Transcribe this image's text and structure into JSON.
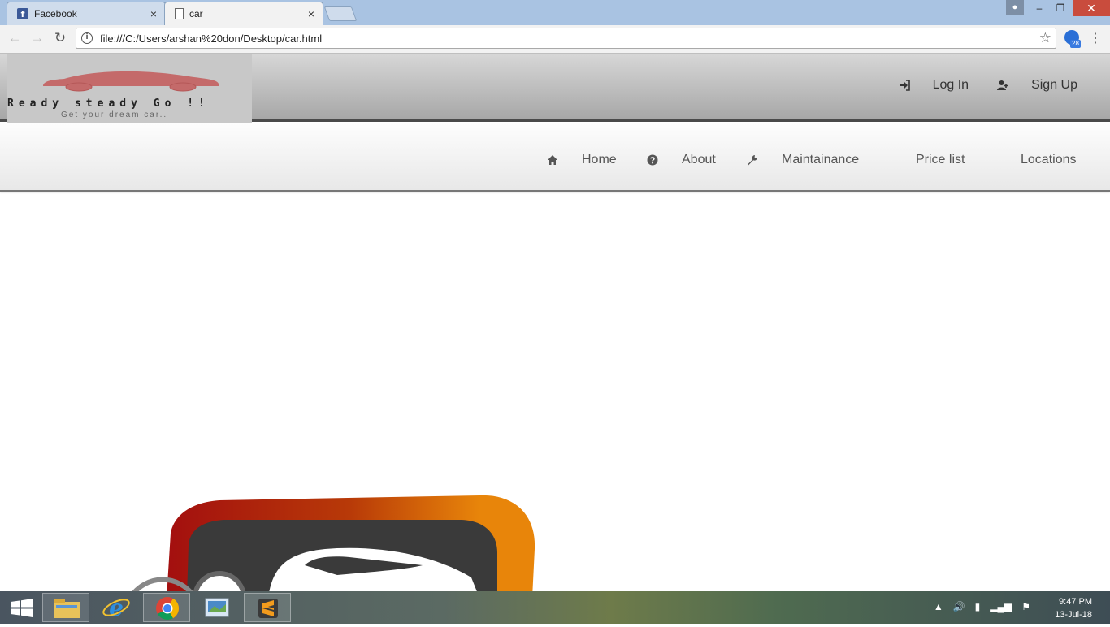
{
  "browser": {
    "tabs": [
      {
        "title": "Facebook",
        "favicon": "facebook-icon",
        "active": false
      },
      {
        "title": "car",
        "favicon": "document-icon",
        "active": true
      }
    ],
    "close_glyph": "×",
    "url": "file:///C:/Users/arshan%20don/Desktop/car.html",
    "extension_badge": "28"
  },
  "site": {
    "tagline": "Ready steady Go !!",
    "subtagline": "Get your dream car..",
    "auth": {
      "login_label": "Log In",
      "signup_label": "Sign Up"
    },
    "nav": [
      {
        "label": "Home",
        "icon": "home-icon"
      },
      {
        "label": "About",
        "icon": "question-circle-icon"
      },
      {
        "label": "Maintainance",
        "icon": "wrench-icon"
      },
      {
        "label": "Price list",
        "icon": ""
      },
      {
        "label": "Locations",
        "icon": ""
      }
    ],
    "colors": {
      "logo_car": "#c46a6a",
      "hero_orange": "#e8850a",
      "hero_red": "#a30f0f"
    }
  },
  "taskbar": {
    "time": "9:47 PM",
    "date": "13-Jul-18"
  }
}
